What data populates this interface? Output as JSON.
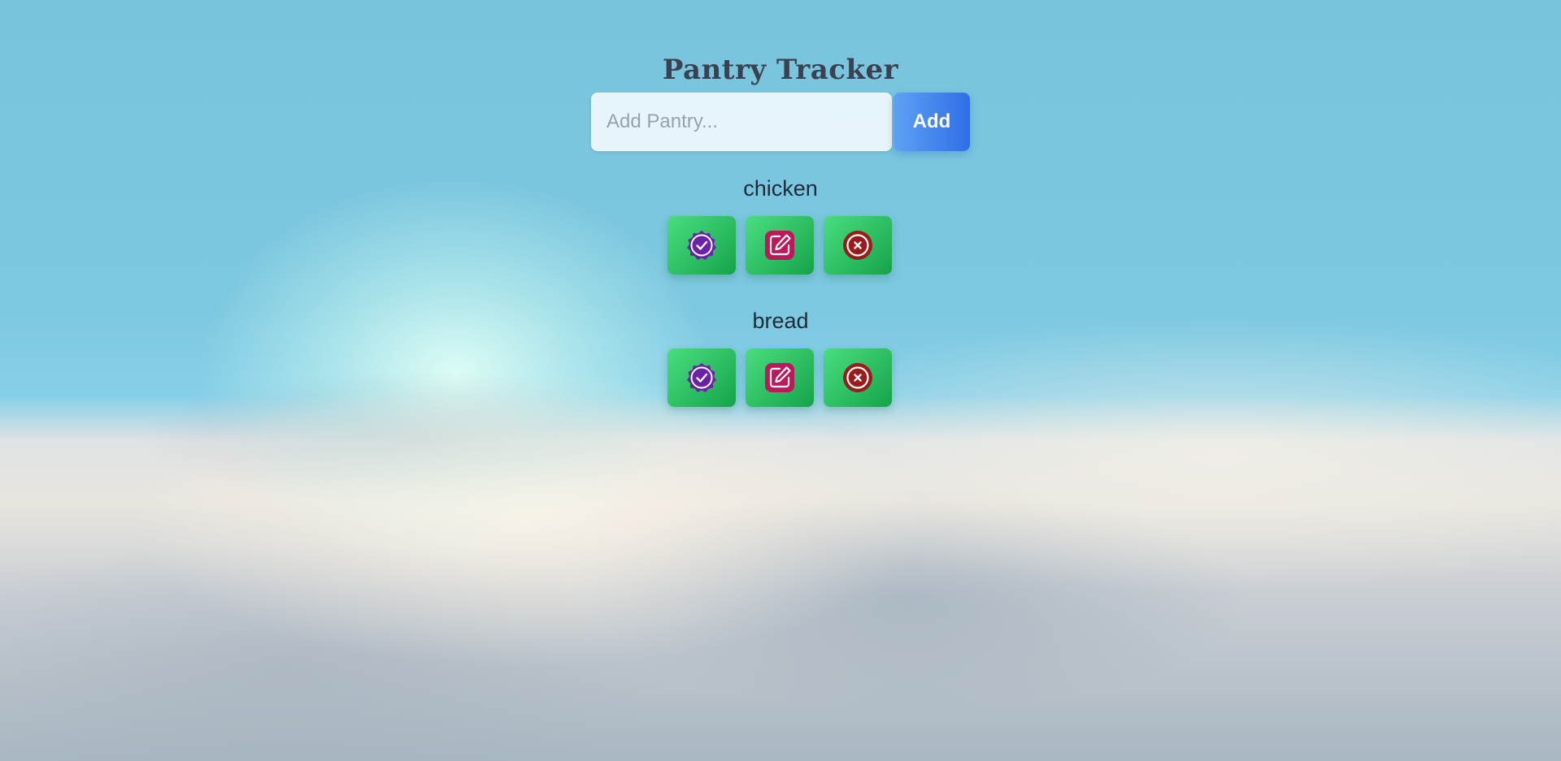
{
  "header": {
    "title": "Pantry Tracker"
  },
  "form": {
    "placeholder": "Add Pantry...",
    "value": "",
    "add_label": "Add"
  },
  "items": [
    {
      "name": "chicken"
    },
    {
      "name": "bread"
    }
  ],
  "icons": {
    "complete": "verified-badge-check-icon",
    "edit": "edit-square-pencil-icon",
    "delete": "circle-x-icon"
  },
  "colors": {
    "title": "#3a4150",
    "add_button_start": "#5ea2f4",
    "add_button_end": "#2f6ee6",
    "action_button_start": "#4ade80",
    "action_button_end": "#16a34a",
    "complete_icon": "#6b21a8",
    "edit_icon": "#be185d",
    "delete_icon": "#991b1b"
  }
}
